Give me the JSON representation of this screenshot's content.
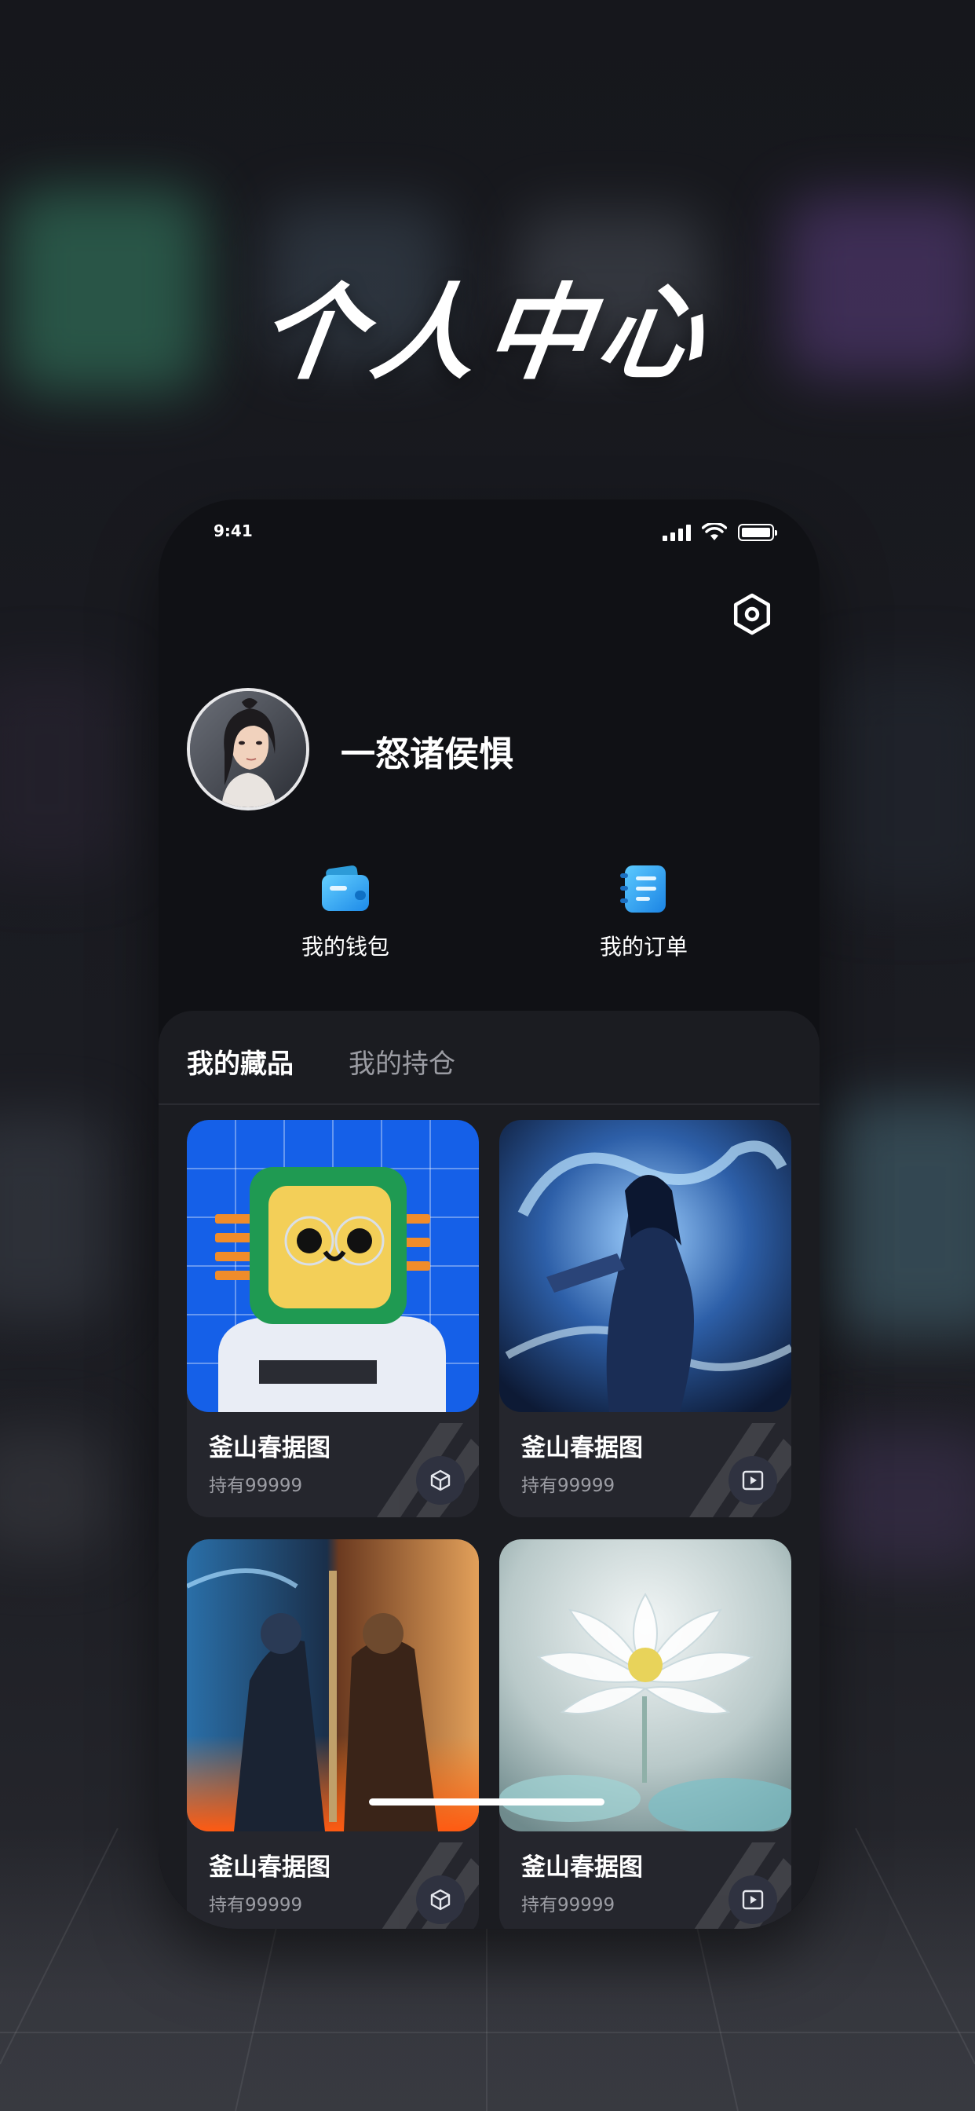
{
  "hero": {
    "title": "个人中心"
  },
  "status_bar": {
    "time": "9:41"
  },
  "profile": {
    "username": "一怒诸侯惧"
  },
  "shortcuts": [
    {
      "label": "我的钱包",
      "icon": "wallet-icon"
    },
    {
      "label": "我的订单",
      "icon": "order-icon"
    }
  ],
  "tabs": [
    {
      "label": "我的藏品",
      "active": true
    },
    {
      "label": "我的持仓",
      "active": false
    }
  ],
  "collections": [
    {
      "title": "釜山春据图",
      "holding": "持有99999",
      "badge_icon": "cube-icon",
      "art": "robot-chip-on-blue-grid"
    },
    {
      "title": "釜山春据图",
      "holding": "持有99999",
      "badge_icon": "video-play-icon",
      "art": "swordsman-with-ice-dragon"
    },
    {
      "title": "釜山春据图",
      "holding": "持有99999",
      "badge_icon": "cube-icon",
      "art": "ice-and-fire-warriors"
    },
    {
      "title": "釜山春据图",
      "holding": "持有99999",
      "badge_icon": "video-play-icon",
      "art": "crystal-lotus"
    }
  ],
  "colors": {
    "page_bg": "#15161b",
    "phone_bg": "#101115",
    "panel_bg": "#1b1c21",
    "card_bg": "#25262d",
    "accent_blue": "#2aa6f5",
    "muted_text": "#9b9ca3"
  }
}
